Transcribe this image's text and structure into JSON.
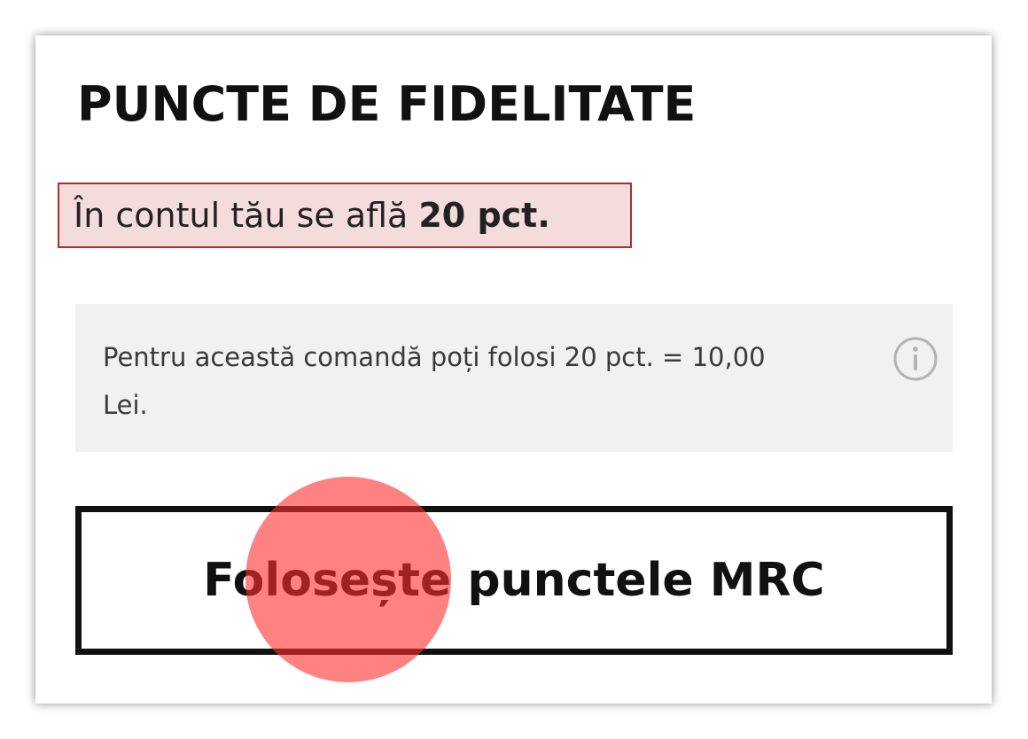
{
  "loyalty": {
    "title": "PUNCTE DE FIDELITATE",
    "balance_prefix": "În contul tău se află",
    "balance_points": "20 pct.",
    "info_text": "Pentru această comandă poți folosi 20 pct. = 10,00 Lei.",
    "info_icon": "info-icon",
    "use_button_label": "Folosește punctele MRC"
  },
  "colors": {
    "highlight_border": "#a4302f",
    "highlight_fill": "#f4dcdc",
    "tap_indicator": "#ff2e2e",
    "info_box_bg": "#f1f1f1",
    "button_border": "#111111"
  }
}
